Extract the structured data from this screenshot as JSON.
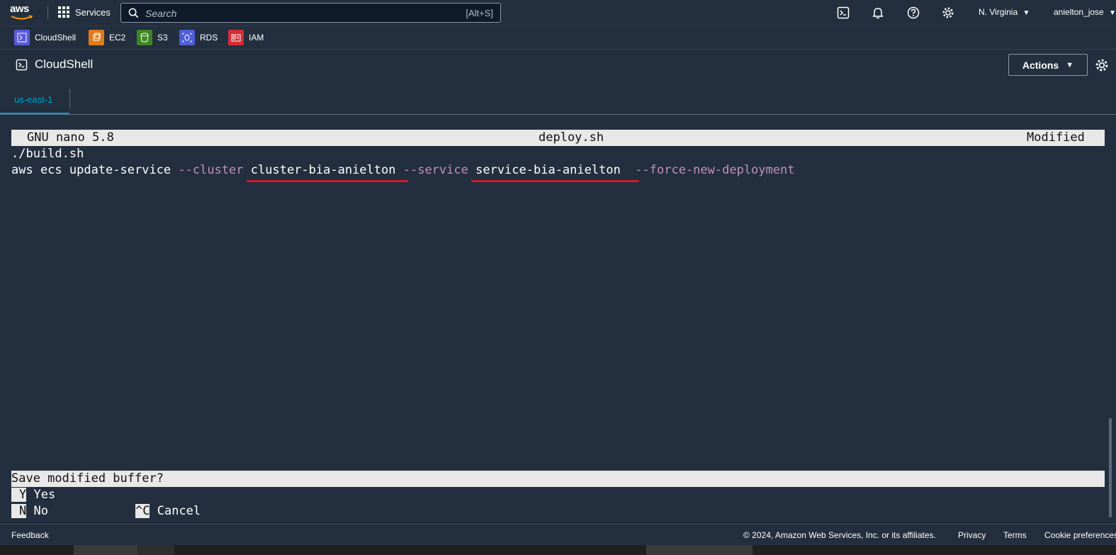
{
  "topnav": {
    "logo_text": "aws",
    "services_label": "Services",
    "search_placeholder": "Search",
    "search_shortcut": "[Alt+S]",
    "region_label": "N. Virginia",
    "user_label": "anielton_jose",
    "icons": [
      "cloudshell-icon",
      "bell-icon",
      "help-icon",
      "gear-icon"
    ]
  },
  "favorites": [
    {
      "label": "CloudShell",
      "color": "#5a5ad8",
      "icon": "cloudshell-icon"
    },
    {
      "label": "EC2",
      "color": "#e07b1a",
      "icon": "ec2-icon"
    },
    {
      "label": "S3",
      "color": "#3f8624",
      "icon": "s3-icon"
    },
    {
      "label": "RDS",
      "color": "#4d5fd6",
      "icon": "rds-icon"
    },
    {
      "label": "IAM",
      "color": "#d12e37",
      "icon": "iam-icon"
    }
  ],
  "cloudshell": {
    "title": "CloudShell",
    "actions_label": "Actions",
    "tab_label": "us-east-1"
  },
  "terminal": {
    "nano_version": "GNU nano 5.8",
    "filename": "deploy.sh",
    "status": "Modified",
    "line1": "./build.sh",
    "cmd_prefix": "aws ecs update-service ",
    "opt_cluster": "--cluster",
    "cluster_value": "cluster-bia-anielton",
    "opt_service": "--service",
    "service_value": "service-bia-anielton",
    "opt_force": "--force-new-deployment",
    "prompt": "Save modified buffer?",
    "key_yes": "Y",
    "label_yes": "Yes",
    "key_no": "N",
    "label_no": "No",
    "key_cancel": "^C",
    "label_cancel": "Cancel"
  },
  "footer": {
    "feedback": "Feedback",
    "copyright": "© 2024, Amazon Web Services, Inc. or its affiliates.",
    "privacy": "Privacy",
    "terms": "Terms",
    "cookies": "Cookie preferences"
  },
  "colors": {
    "background": "#232f3e",
    "accent": "#00a1c9",
    "option": "#c28fbd",
    "underline": "#d11a2a"
  }
}
